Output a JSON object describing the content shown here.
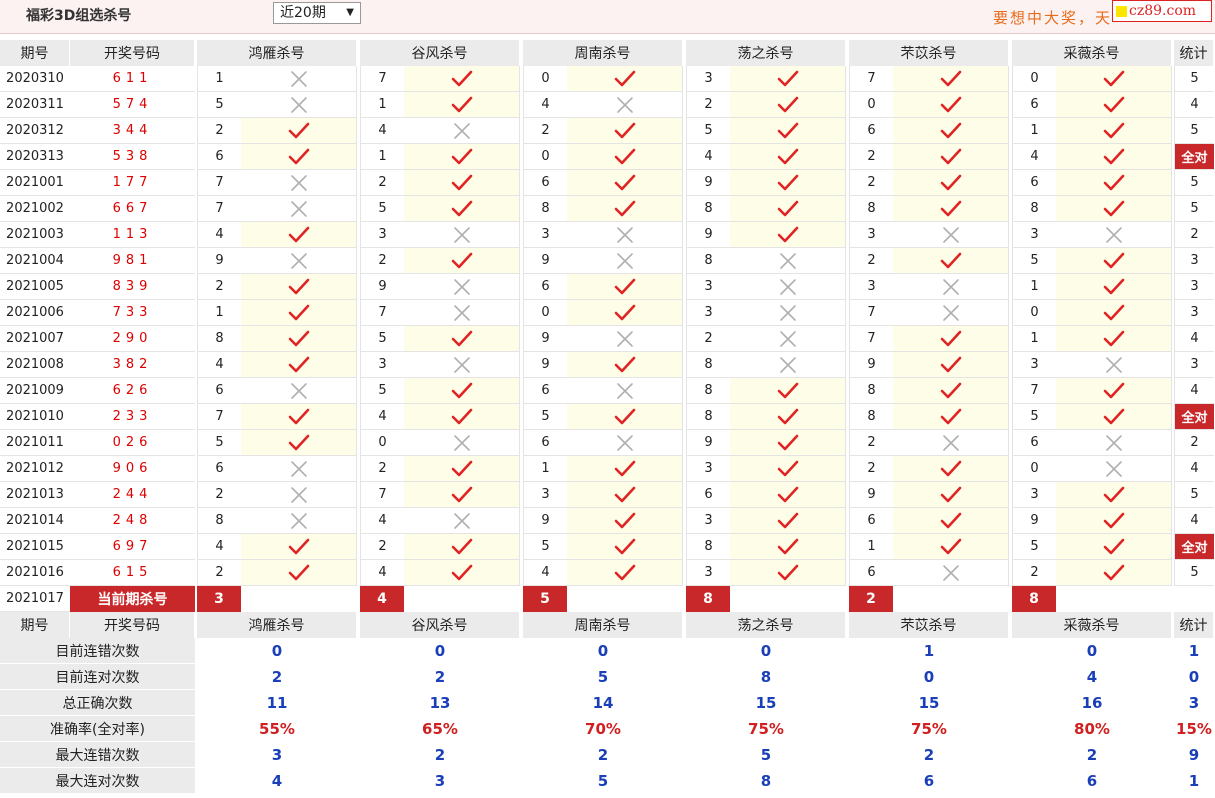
{
  "header": {
    "title": "福彩3D组选杀号",
    "period_select": "近20期",
    "marquee": "要想中大奖，天",
    "site": "cz89.com"
  },
  "columns": {
    "issue": "期号",
    "draw": "开奖号码",
    "count": "统计"
  },
  "experts": [
    "鸿雁杀号",
    "谷风杀号",
    "周南杀号",
    "荡之杀号",
    "芣苡杀号",
    "采薇杀号"
  ],
  "rows": [
    {
      "issue": "2020310",
      "draw": "611",
      "k": [
        [
          "1",
          0
        ],
        [
          "7",
          1
        ],
        [
          "0",
          1
        ],
        [
          "3",
          1
        ],
        [
          "7",
          1
        ],
        [
          "0",
          1
        ]
      ],
      "count": "5"
    },
    {
      "issue": "2020311",
      "draw": "574",
      "k": [
        [
          "5",
          0
        ],
        [
          "1",
          1
        ],
        [
          "4",
          0
        ],
        [
          "2",
          1
        ],
        [
          "0",
          1
        ],
        [
          "6",
          1
        ]
      ],
      "count": "4"
    },
    {
      "issue": "2020312",
      "draw": "344",
      "k": [
        [
          "2",
          1
        ],
        [
          "4",
          0
        ],
        [
          "2",
          1
        ],
        [
          "5",
          1
        ],
        [
          "6",
          1
        ],
        [
          "1",
          1
        ]
      ],
      "count": "5"
    },
    {
      "issue": "2020313",
      "draw": "538",
      "k": [
        [
          "6",
          1
        ],
        [
          "1",
          1
        ],
        [
          "0",
          1
        ],
        [
          "4",
          1
        ],
        [
          "2",
          1
        ],
        [
          "4",
          1
        ]
      ],
      "count": "全对"
    },
    {
      "issue": "2021001",
      "draw": "177",
      "k": [
        [
          "7",
          0
        ],
        [
          "2",
          1
        ],
        [
          "6",
          1
        ],
        [
          "9",
          1
        ],
        [
          "2",
          1
        ],
        [
          "6",
          1
        ]
      ],
      "count": "5"
    },
    {
      "issue": "2021002",
      "draw": "667",
      "k": [
        [
          "7",
          0
        ],
        [
          "5",
          1
        ],
        [
          "8",
          1
        ],
        [
          "8",
          1
        ],
        [
          "8",
          1
        ],
        [
          "8",
          1
        ]
      ],
      "count": "5"
    },
    {
      "issue": "2021003",
      "draw": "113",
      "k": [
        [
          "4",
          1
        ],
        [
          "3",
          0
        ],
        [
          "3",
          0
        ],
        [
          "9",
          1
        ],
        [
          "3",
          0
        ],
        [
          "3",
          0
        ]
      ],
      "count": "2"
    },
    {
      "issue": "2021004",
      "draw": "981",
      "k": [
        [
          "9",
          0
        ],
        [
          "2",
          1
        ],
        [
          "9",
          0
        ],
        [
          "8",
          0
        ],
        [
          "2",
          1
        ],
        [
          "5",
          1
        ]
      ],
      "count": "3"
    },
    {
      "issue": "2021005",
      "draw": "839",
      "k": [
        [
          "2",
          1
        ],
        [
          "9",
          0
        ],
        [
          "6",
          1
        ],
        [
          "3",
          0
        ],
        [
          "3",
          0
        ],
        [
          "1",
          1
        ]
      ],
      "count": "3"
    },
    {
      "issue": "2021006",
      "draw": "733",
      "k": [
        [
          "1",
          1
        ],
        [
          "7",
          0
        ],
        [
          "0",
          1
        ],
        [
          "3",
          0
        ],
        [
          "7",
          0
        ],
        [
          "0",
          1
        ]
      ],
      "count": "3"
    },
    {
      "issue": "2021007",
      "draw": "290",
      "k": [
        [
          "8",
          1
        ],
        [
          "5",
          1
        ],
        [
          "9",
          0
        ],
        [
          "2",
          0
        ],
        [
          "7",
          1
        ],
        [
          "1",
          1
        ]
      ],
      "count": "4"
    },
    {
      "issue": "2021008",
      "draw": "382",
      "k": [
        [
          "4",
          1
        ],
        [
          "3",
          0
        ],
        [
          "9",
          1
        ],
        [
          "8",
          0
        ],
        [
          "9",
          1
        ],
        [
          "3",
          0
        ]
      ],
      "count": "3"
    },
    {
      "issue": "2021009",
      "draw": "626",
      "k": [
        [
          "6",
          0
        ],
        [
          "5",
          1
        ],
        [
          "6",
          0
        ],
        [
          "8",
          1
        ],
        [
          "8",
          1
        ],
        [
          "7",
          1
        ]
      ],
      "count": "4"
    },
    {
      "issue": "2021010",
      "draw": "233",
      "k": [
        [
          "7",
          1
        ],
        [
          "4",
          1
        ],
        [
          "5",
          1
        ],
        [
          "8",
          1
        ],
        [
          "8",
          1
        ],
        [
          "5",
          1
        ]
      ],
      "count": "全对"
    },
    {
      "issue": "2021011",
      "draw": "026",
      "k": [
        [
          "5",
          1
        ],
        [
          "0",
          0
        ],
        [
          "6",
          0
        ],
        [
          "9",
          1
        ],
        [
          "2",
          0
        ],
        [
          "6",
          0
        ]
      ],
      "count": "2"
    },
    {
      "issue": "2021012",
      "draw": "906",
      "k": [
        [
          "6",
          0
        ],
        [
          "2",
          1
        ],
        [
          "1",
          1
        ],
        [
          "3",
          1
        ],
        [
          "2",
          1
        ],
        [
          "0",
          0
        ]
      ],
      "count": "4"
    },
    {
      "issue": "2021013",
      "draw": "244",
      "k": [
        [
          "2",
          0
        ],
        [
          "7",
          1
        ],
        [
          "3",
          1
        ],
        [
          "6",
          1
        ],
        [
          "9",
          1
        ],
        [
          "3",
          1
        ]
      ],
      "count": "5"
    },
    {
      "issue": "2021014",
      "draw": "248",
      "k": [
        [
          "8",
          0
        ],
        [
          "4",
          0
        ],
        [
          "9",
          1
        ],
        [
          "3",
          1
        ],
        [
          "6",
          1
        ],
        [
          "9",
          1
        ]
      ],
      "count": "4"
    },
    {
      "issue": "2021015",
      "draw": "697",
      "k": [
        [
          "4",
          1
        ],
        [
          "2",
          1
        ],
        [
          "5",
          1
        ],
        [
          "8",
          1
        ],
        [
          "1",
          1
        ],
        [
          "5",
          1
        ]
      ],
      "count": "全对"
    },
    {
      "issue": "2021016",
      "draw": "615",
      "k": [
        [
          "2",
          1
        ],
        [
          "4",
          1
        ],
        [
          "4",
          1
        ],
        [
          "3",
          1
        ],
        [
          "6",
          0
        ],
        [
          "2",
          1
        ]
      ],
      "count": "5"
    }
  ],
  "current": {
    "issue": "2021017",
    "label": "当前期杀号",
    "kills": [
      "3",
      "4",
      "5",
      "8",
      "2",
      "8"
    ]
  },
  "stats": [
    {
      "label": "目前连错次数",
      "values": [
        "0",
        "0",
        "0",
        "0",
        "1",
        "0"
      ],
      "count": "1",
      "rate": false
    },
    {
      "label": "目前连对次数",
      "values": [
        "2",
        "2",
        "5",
        "8",
        "0",
        "4"
      ],
      "count": "0",
      "rate": false
    },
    {
      "label": "总正确次数",
      "values": [
        "11",
        "13",
        "14",
        "15",
        "15",
        "16"
      ],
      "count": "3",
      "rate": false
    },
    {
      "label": "准确率(全对率)",
      "values": [
        "55%",
        "65%",
        "70%",
        "75%",
        "75%",
        "80%"
      ],
      "count": "15%",
      "rate": true
    },
    {
      "label": "最大连错次数",
      "values": [
        "3",
        "2",
        "2",
        "5",
        "2",
        "2"
      ],
      "count": "9",
      "rate": false
    },
    {
      "label": "最大连对次数",
      "values": [
        "4",
        "3",
        "5",
        "8",
        "6",
        "6"
      ],
      "count": "1",
      "rate": false
    }
  ],
  "icons": {
    "hit": "check-icon",
    "miss": "cross-icon"
  },
  "colors": {
    "check": "#e02424",
    "cross": "#b0b0b0",
    "full": "#c8282a",
    "stat": "#1a3fb8",
    "rate": "#d02020"
  }
}
